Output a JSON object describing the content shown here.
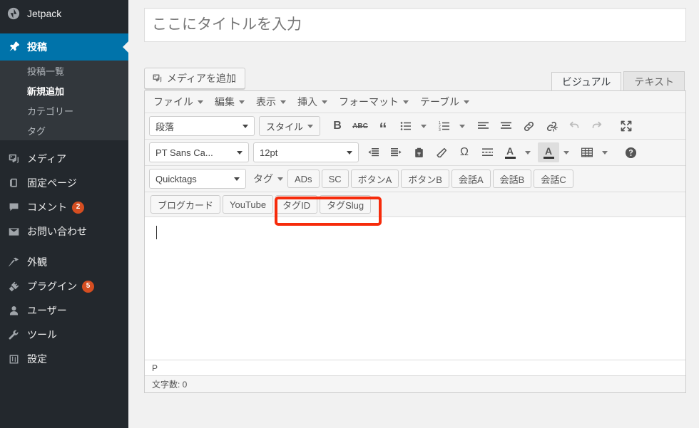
{
  "colors": {
    "sidebar_bg": "#23282d",
    "sidebar_sub_bg": "#32373c",
    "accent_blue": "#0073aa",
    "badge_orange": "#d54e21",
    "highlight_red": "#f62b0b",
    "page_bg": "#f1f1f1"
  },
  "sidebar": {
    "jetpack": {
      "label": "Jetpack",
      "icon": "jetpack-icon"
    },
    "items": [
      {
        "label": "投稿",
        "icon": "pin-icon",
        "current": true,
        "name": "posts"
      },
      {
        "label": "メディア",
        "icon": "media-icon",
        "current": false,
        "name": "media"
      },
      {
        "label": "固定ページ",
        "icon": "page-icon",
        "current": false,
        "name": "pages"
      },
      {
        "label": "コメント",
        "icon": "comment-icon",
        "current": false,
        "name": "comments",
        "badge": "2"
      },
      {
        "label": "お問い合わせ",
        "icon": "mail-icon",
        "current": false,
        "name": "contact"
      },
      {
        "label": "外観",
        "icon": "appearance-icon",
        "current": false,
        "name": "appearance"
      },
      {
        "label": "プラグイン",
        "icon": "plugin-icon",
        "current": false,
        "name": "plugins",
        "badge": "5"
      },
      {
        "label": "ユーザー",
        "icon": "user-icon",
        "current": false,
        "name": "users"
      },
      {
        "label": "ツール",
        "icon": "wrench-icon",
        "current": false,
        "name": "tools"
      },
      {
        "label": "設定",
        "icon": "settings-icon",
        "current": false,
        "name": "settings"
      }
    ],
    "submenu": [
      {
        "label": "投稿一覧",
        "active": false
      },
      {
        "label": "新規追加",
        "active": true
      },
      {
        "label": "カテゴリー",
        "active": false
      },
      {
        "label": "タグ",
        "active": false
      }
    ]
  },
  "post": {
    "title_placeholder": "ここにタイトルを入力",
    "title_value": "",
    "add_media_label": "メディアを追加",
    "editor_tabs": [
      {
        "label": "ビジュアル",
        "active": true
      },
      {
        "label": "テキスト",
        "active": false
      }
    ]
  },
  "editor": {
    "menubar": [
      {
        "label": "ファイル"
      },
      {
        "label": "編集"
      },
      {
        "label": "表示"
      },
      {
        "label": "挿入"
      },
      {
        "label": "フォーマット"
      },
      {
        "label": "テーブル"
      }
    ],
    "row1": {
      "format_select": "段落",
      "style_button": "スタイル",
      "bold": "B",
      "strikethrough": "ABC",
      "blockquote": "“",
      "bullet_list": "bullet-list-icon",
      "numbered_list": "numbered-list-icon",
      "align_left": "align-left-icon",
      "align_center": "align-center-icon",
      "link": "link-icon",
      "unlink": "unlink-icon",
      "undo": "undo-icon",
      "redo": "redo-icon",
      "fullscreen": "fullscreen-icon"
    },
    "row2": {
      "font_select": "PT Sans Ca...",
      "size_select": "12pt",
      "outdent": "outdent-icon",
      "indent": "indent-icon",
      "paste_text": "paste-text-icon",
      "eraser": "eraser-icon",
      "special_char": "Ω",
      "read_more": "read-more-icon",
      "text_color": "A",
      "background_color": "A",
      "table": "table-icon",
      "help": "help-icon"
    },
    "quicktags_row": {
      "quicktags_select": "Quicktags",
      "tag_select": "タグ",
      "buttons": [
        "ADs",
        "SC",
        "ボタンA",
        "ボタンB",
        "会話A",
        "会話B",
        "会話C"
      ]
    },
    "shortcode_row": {
      "buttons": [
        "ブログカード",
        "YouTube",
        "タグID",
        "タグSlug"
      ]
    },
    "content_value": "",
    "path_bar": "P",
    "word_count": "文字数: 0"
  }
}
